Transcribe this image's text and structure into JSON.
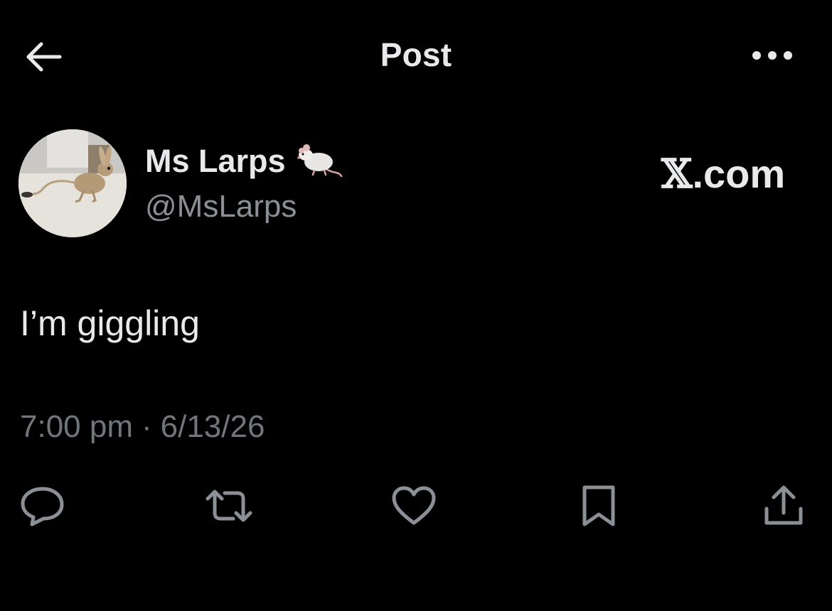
{
  "header": {
    "title": "Post",
    "back_icon": "arrow-left-icon",
    "more_icon": "more-horizontal-icon"
  },
  "author": {
    "display_name": "Ms Larps",
    "name_emoji": "rat-emoji",
    "handle": "@MsLarps",
    "avatar": "jerboa-photo"
  },
  "brand": {
    "x_glyph": "𝕏",
    "suffix": ".com"
  },
  "post": {
    "text": "I’m giggling",
    "time": "7:00 pm",
    "separator": "·",
    "date": "6/13/26"
  },
  "actions": [
    {
      "name": "reply",
      "icon": "reply-icon"
    },
    {
      "name": "repost",
      "icon": "repost-icon"
    },
    {
      "name": "like",
      "icon": "heart-icon"
    },
    {
      "name": "bookmark",
      "icon": "bookmark-icon"
    },
    {
      "name": "share",
      "icon": "share-icon"
    }
  ],
  "colors": {
    "background": "#000000",
    "primary_text": "#e7e9ea",
    "secondary_text": "#71767b",
    "icon": "#8b9096"
  }
}
